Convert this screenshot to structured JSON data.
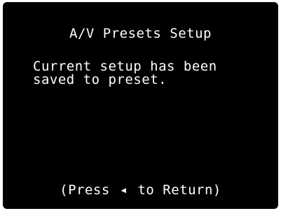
{
  "screen": {
    "title": "A/V Presets Setup",
    "message_line1": "Current setup has been",
    "message_line2": "saved to preset.",
    "footer": {
      "prefix": "(Press",
      "arrow_icon": "left-arrow-icon",
      "arrow_glyph": "◀",
      "suffix": "to Return)"
    }
  }
}
